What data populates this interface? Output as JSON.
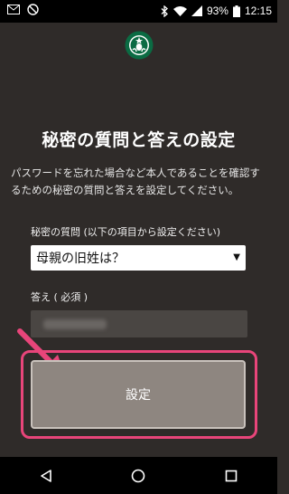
{
  "status_bar": {
    "battery": "93%",
    "time": "12:15",
    "icons": [
      "mail-icon",
      "no-disturb-icon",
      "bluetooth-icon",
      "wifi-icon",
      "signal-icon",
      "battery-icon"
    ]
  },
  "header": {
    "logo": "starbucks-logo"
  },
  "page": {
    "title": "秘密の質問と答えの設定",
    "description": "パスワードを忘れた場合など本人であることを確認するための秘密の質問と答えを設定してください。"
  },
  "form": {
    "question_label": "秘密の質問 (以下の項目から設定ください)",
    "question_selected": "母親の旧姓は？",
    "answer_label": "答え ( 必須 )",
    "answer_value": "",
    "submit_label": "設定"
  },
  "nav_bar": {
    "icons": [
      "back-icon",
      "home-icon",
      "recents-icon"
    ]
  },
  "colors": {
    "background": "#2f2b29",
    "highlight": "#e8457a",
    "button": "#8e8680"
  }
}
